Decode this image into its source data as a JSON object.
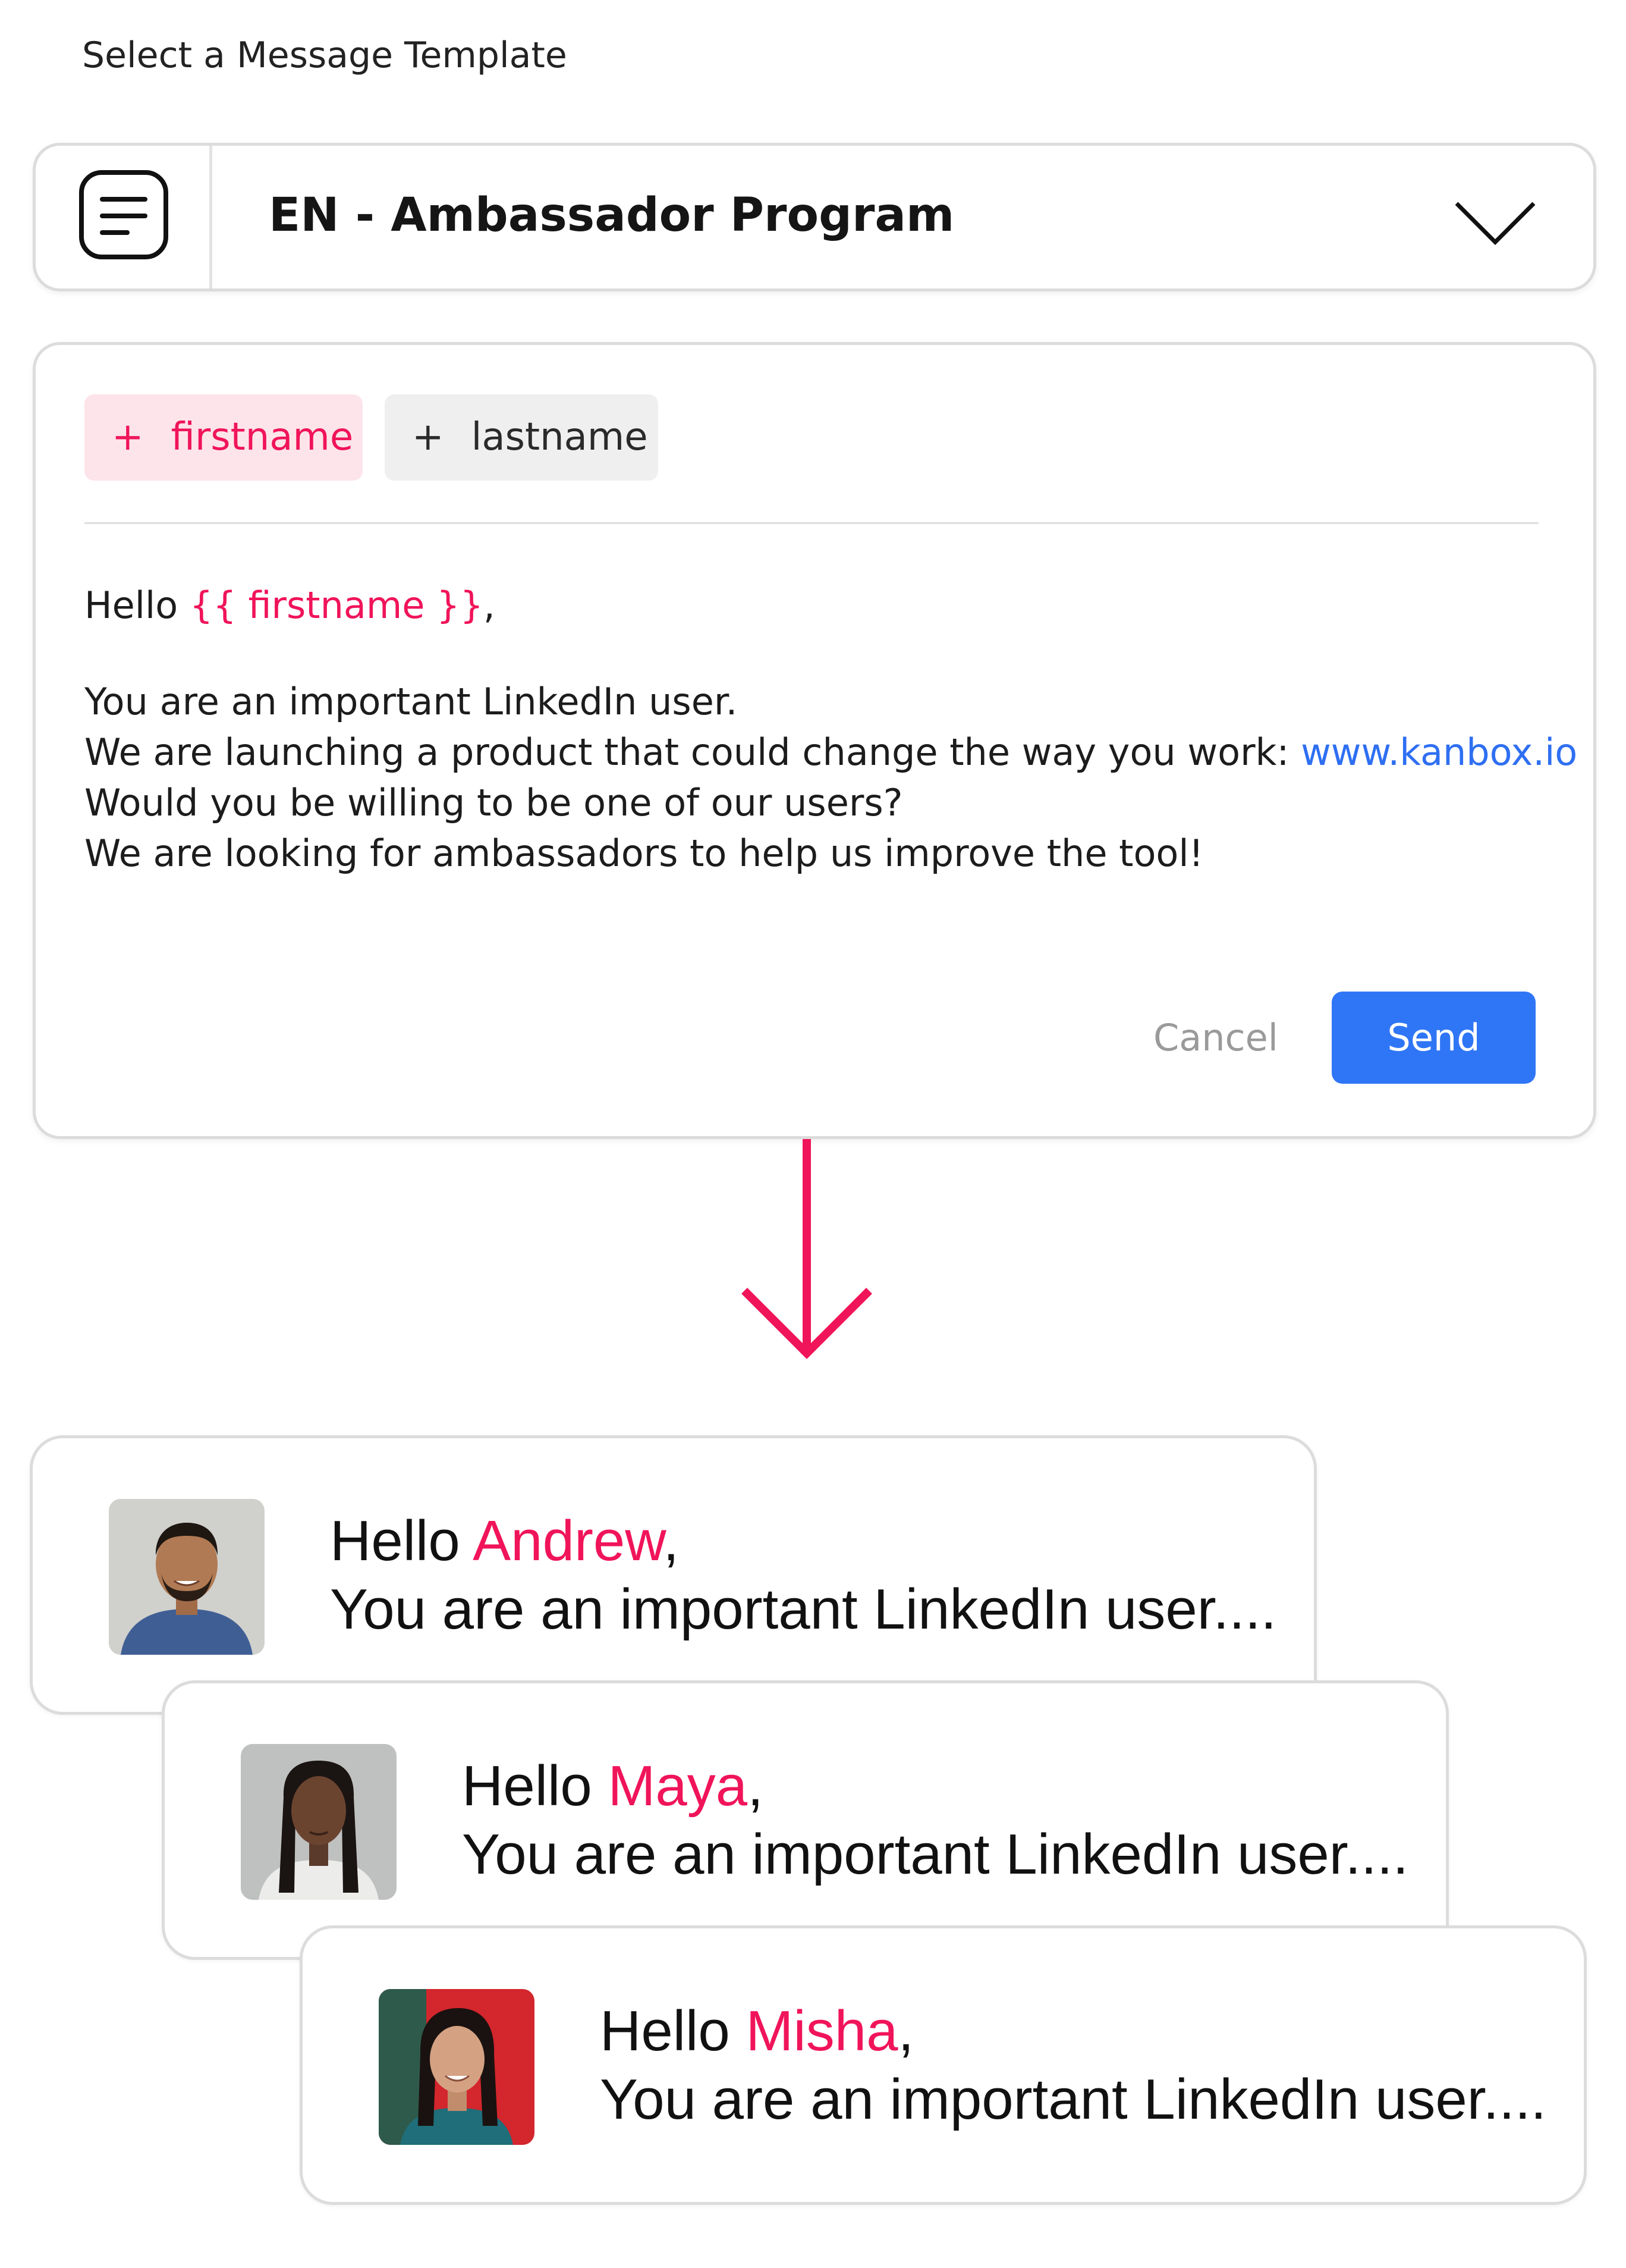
{
  "section_label": "Select a Message Template",
  "template_select": {
    "selected": "EN - Ambassador Program"
  },
  "variables": [
    {
      "label": "firstname",
      "plus": "+"
    },
    {
      "label": "lastname",
      "plus": "+"
    }
  ],
  "message": {
    "greeting_prefix": "Hello ",
    "greeting_variable": "{{ firstname }}",
    "greeting_suffix": ",",
    "line_1": "You are an important LinkedIn user.",
    "line_2_prefix": "We are launching a product that could change the way you work: ",
    "line_2_link": "www.kanbox.io",
    "line_3": "Would you be willing to be one of our users?",
    "line_4": "We are looking for ambassadors to help us improve the tool!"
  },
  "actions": {
    "cancel": "Cancel",
    "send": "Send"
  },
  "previews": [
    {
      "prefix": "Hello ",
      "name": "Andrew",
      "suffix": ",",
      "body": "You are an important LinkedIn user...."
    },
    {
      "prefix": "Hello ",
      "name": "Maya",
      "suffix": ",",
      "body": "You are an important LinkedIn user...."
    },
    {
      "prefix": "Hello ",
      "name": "Misha",
      "suffix": ",",
      "body": "You are an important LinkedIn user...."
    }
  ],
  "colors": {
    "accent_pink": "#f0145a",
    "link_blue": "#2e6ff2",
    "send_blue": "#2f76f6"
  },
  "icons": {
    "template": "document-lines-icon",
    "dropdown": "chevron-down-icon",
    "flow": "arrow-down-icon"
  }
}
